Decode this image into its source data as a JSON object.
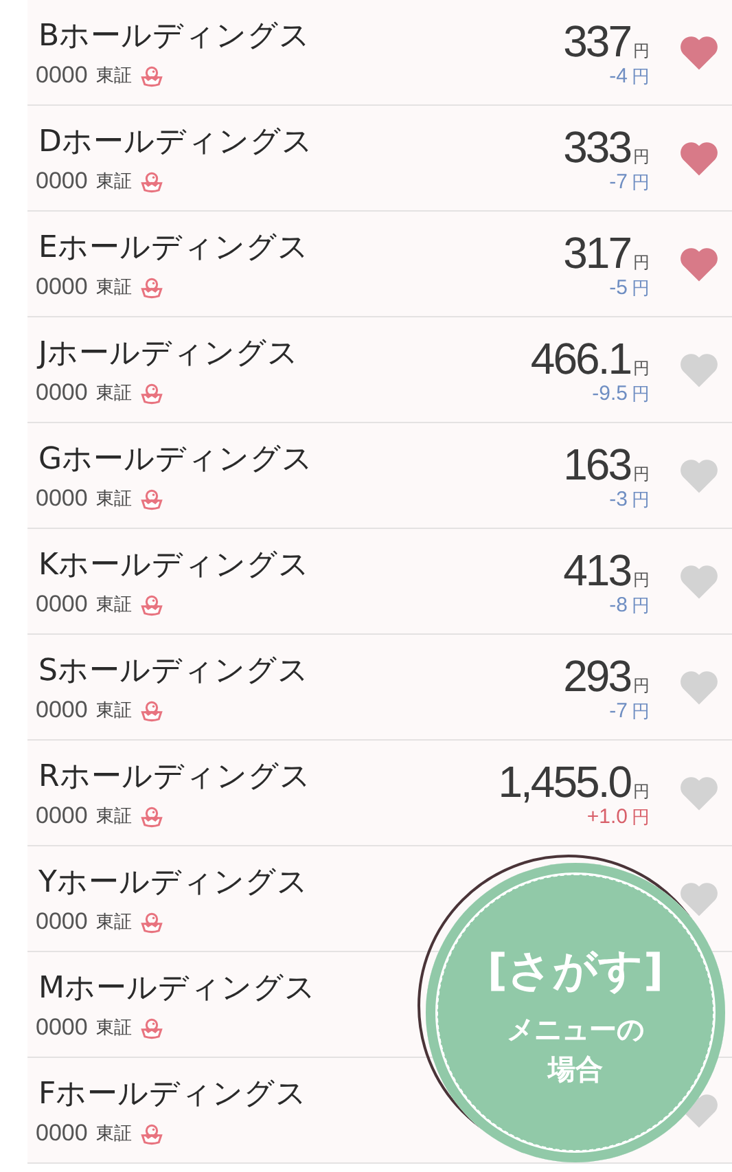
{
  "stocks": [
    {
      "name": "Bホールディングス",
      "code": "0000",
      "market": "東証",
      "price": "337",
      "price_unit": "円",
      "change": "-4",
      "change_unit": "円",
      "color": "#6f8ec2",
      "favorite": true
    },
    {
      "name": "Dホールディングス",
      "code": "0000",
      "market": "東証",
      "price": "333",
      "price_unit": "円",
      "change": "-7",
      "change_unit": "円",
      "color": "#6f8ec2",
      "favorite": true
    },
    {
      "name": "Eホールディングス",
      "code": "0000",
      "market": "東証",
      "price": "317",
      "price_unit": "円",
      "change": "-5",
      "change_unit": "円",
      "color": "#6f8ec2",
      "favorite": true
    },
    {
      "name": "Jホールディングス",
      "code": "0000",
      "market": "東証",
      "price": "466.1",
      "price_unit": "円",
      "change": "-9.5",
      "change_unit": "円",
      "color": "#6f8ec2",
      "favorite": false
    },
    {
      "name": "Gホールディングス",
      "code": "0000",
      "market": "東証",
      "price": "163",
      "price_unit": "円",
      "change": "-3",
      "change_unit": "円",
      "color": "#6f8ec2",
      "favorite": false
    },
    {
      "name": "Kホールディングス",
      "code": "0000",
      "market": "東証",
      "price": "413",
      "price_unit": "円",
      "change": "-8",
      "change_unit": "円",
      "color": "#6f8ec2",
      "favorite": false
    },
    {
      "name": "Sホールディングス",
      "code": "0000",
      "market": "東証",
      "price": "293",
      "price_unit": "円",
      "change": "-7",
      "change_unit": "円",
      "color": "#6f8ec2",
      "favorite": false
    },
    {
      "name": "Rホールディングス",
      "code": "0000",
      "market": "東証",
      "price": "1,455.0",
      "price_unit": "円",
      "change": "+1.0",
      "change_unit": "円",
      "color": "#d8606a",
      "favorite": false
    },
    {
      "name": "Yホールディングス",
      "code": "0000",
      "market": "東証",
      "favorite": false
    },
    {
      "name": "Mホールディングス",
      "code": "0000",
      "market": "東証"
    },
    {
      "name": "Fホールディングス",
      "code": "0000",
      "market": "東証",
      "favorite": false
    }
  ],
  "badge": {
    "title": "[さがす]",
    "subtitle": "メニューの場合"
  }
}
